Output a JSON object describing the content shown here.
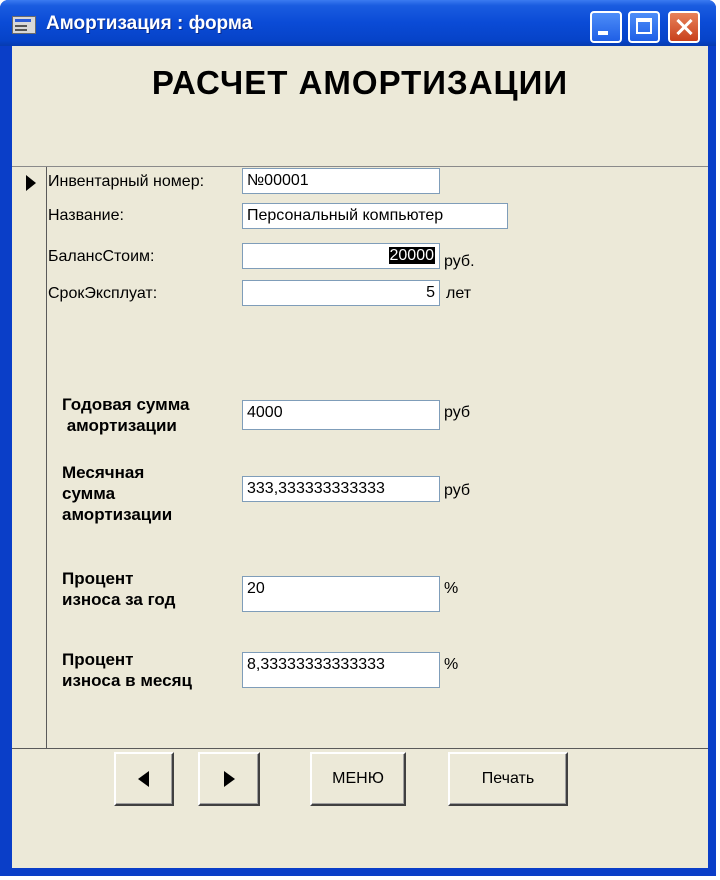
{
  "window": {
    "title": "Амортизация : форма"
  },
  "form": {
    "title": "РАСЧЕТ АМОРТИЗАЦИИ"
  },
  "fields": {
    "inventory": {
      "label": "Инвентарный номер:",
      "value": "№00001"
    },
    "name": {
      "label": "Название:",
      "value": "Персональный компьютер"
    },
    "balance": {
      "label": "БалансСтоим:",
      "value": "20000",
      "unit": "руб."
    },
    "term": {
      "label": "СрокЭксплуат:",
      "value": "5",
      "unit": "лет"
    },
    "annual": {
      "label_line1": "Годовая сумма",
      "label_line2": " амортизации",
      "value": "4000",
      "unit": "руб"
    },
    "monthly": {
      "label_line1": "Месячная",
      "label_line2": "сумма",
      "label_line3": "амортизации",
      "value": "333,333333333333",
      "unit": "руб"
    },
    "wear_year": {
      "label_line1": "Процент",
      "label_line2": "износа за год",
      "value": "20",
      "unit": "%"
    },
    "wear_month": {
      "label_line1": "Процент",
      "label_line2": "износа в месяц",
      "value": "8,33333333333333",
      "unit": "%"
    }
  },
  "buttons": {
    "menu": "МЕНЮ",
    "print": "Печать"
  },
  "icons": {
    "prev": "triangle-left-icon",
    "next": "triangle-right-icon",
    "record_pointer": "record-pointer-icon"
  },
  "colors": {
    "titlebar": "#0a4bd6",
    "form_background": "#ece9d8",
    "close_button": "#c8401c"
  }
}
